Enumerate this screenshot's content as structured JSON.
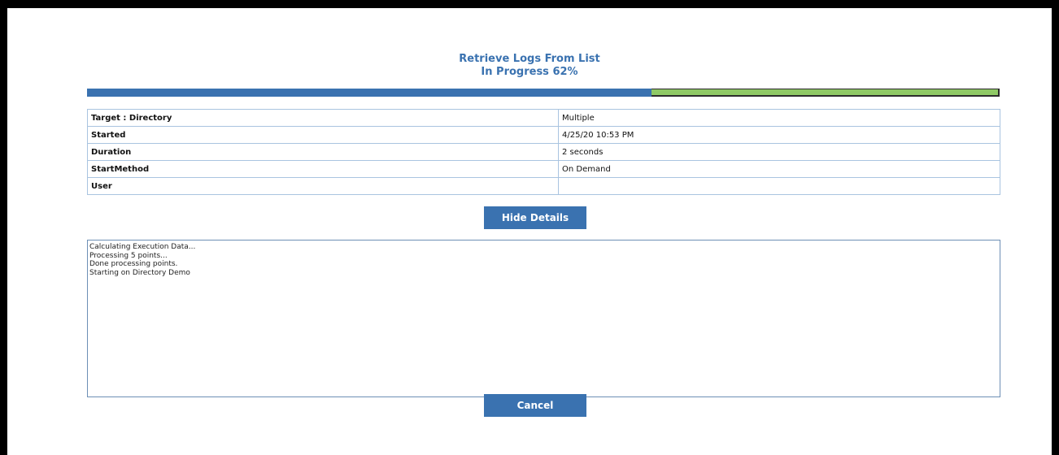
{
  "header": {
    "title": "Retrieve Logs From List",
    "status": "In Progress 62%"
  },
  "progress": {
    "percent": 62,
    "fill_color": "#3a72b0",
    "track_color": "#8fc965"
  },
  "details": [
    {
      "label": "Target : Directory",
      "value": "Multiple"
    },
    {
      "label": "Started",
      "value": "4/25/20 10:53 PM"
    },
    {
      "label": "Duration",
      "value": "2 seconds"
    },
    {
      "label": "StartMethod",
      "value": "On Demand"
    },
    {
      "label": "User",
      "value": ""
    }
  ],
  "buttons": {
    "hide_details": "Hide Details",
    "cancel": "Cancel"
  },
  "log": {
    "lines": [
      "Calculating Execution Data...",
      "Processing 5 points...",
      "Done processing points.",
      "Starting on Directory Demo"
    ]
  }
}
